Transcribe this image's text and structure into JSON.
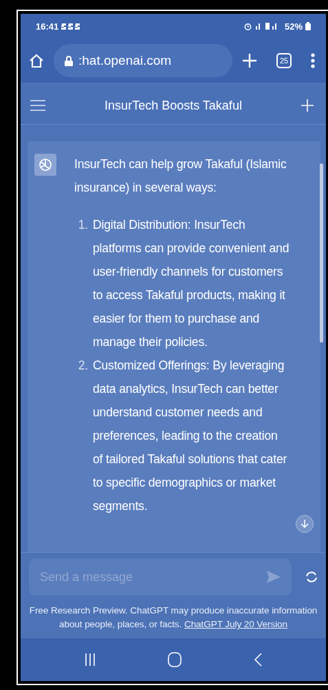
{
  "status_bar": {
    "time": "16:41",
    "battery": "52%"
  },
  "browser": {
    "url": ":hat.openai.com",
    "tab_count": "25"
  },
  "chat": {
    "title": "InsurTech Boosts Takaful"
  },
  "message": {
    "intro": "InsurTech can help grow Takaful (Islamic insurance) in several ways:",
    "items": [
      {
        "number": "1.",
        "text": "Digital Distribution: InsurTech platforms can provide convenient and user-friendly channels for customers to access Takaful products, making it easier for them to purchase and manage their policies."
      },
      {
        "number": "2.",
        "text": "Customized Offerings: By leveraging data analytics, InsurTech can better understand customer needs and preferences, leading to the creation of tailored Takaful solutions that cater to specific demographics or market segments."
      }
    ]
  },
  "composer": {
    "placeholder": "Send a message"
  },
  "disclaimer": {
    "text": "Free Research Preview. ChatGPT may produce inaccurate information about people, places, or facts.",
    "link": "ChatGPT July 20 Version"
  }
}
